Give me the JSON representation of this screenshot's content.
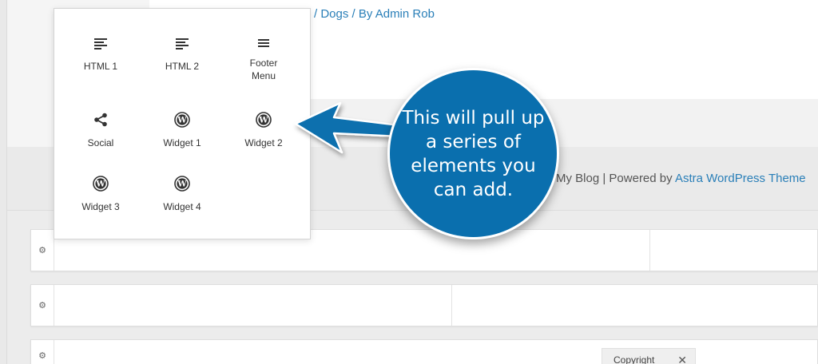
{
  "breadcrumb": "ent / Dogs / By Admin Rob",
  "footer": {
    "prefix": "My Blog | Powered by ",
    "link": "Astra WordPress Theme"
  },
  "elements": [
    {
      "label": "HTML 1",
      "icon": "html-icon"
    },
    {
      "label": "HTML 2",
      "icon": "html-icon"
    },
    {
      "label": "Footer Menu",
      "icon": "menu-icon"
    },
    {
      "label": "Social",
      "icon": "share-icon"
    },
    {
      "label": "Widget 1",
      "icon": "wordpress-icon"
    },
    {
      "label": "Widget 2",
      "icon": "wordpress-icon"
    },
    {
      "label": "Widget 3",
      "icon": "wordpress-icon"
    },
    {
      "label": "Widget 4",
      "icon": "wordpress-icon"
    }
  ],
  "callout": "This will pull up a series of elements you can add.",
  "copyright_chip": {
    "label": "Copyright",
    "close": "✕"
  },
  "gear": "⚙",
  "colors": {
    "callout_bg": "#0a6fae",
    "link": "#2a7fb8"
  }
}
